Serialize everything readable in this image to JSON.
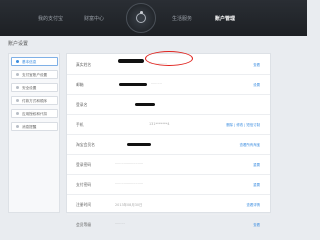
{
  "nav": {
    "items": [
      {
        "label": "我的支付宝"
      },
      {
        "label": "财富中心"
      },
      {
        "label": "生活服务"
      },
      {
        "label": "账户管理",
        "active": true
      }
    ]
  },
  "page": {
    "title": "账户设置"
  },
  "sidebar": {
    "items": [
      {
        "label": "基本信息",
        "active": true
      },
      {
        "label": "支付宝账户设置"
      },
      {
        "label": "安全设置"
      },
      {
        "label": "付款方式和顺序"
      },
      {
        "label": "应用授权和代扣"
      },
      {
        "label": "消息提醒"
      }
    ]
  },
  "rows": [
    {
      "label": "真实姓名",
      "value": "·················",
      "link": "查看"
    },
    {
      "label": "邮箱",
      "value": "··········",
      "link": "设置"
    },
    {
      "label": "登录名",
      "value": "",
      "link": ""
    },
    {
      "label": "手机",
      "value": "131*******4",
      "link": "删除 | 修改 | 短信订制"
    },
    {
      "label": "淘宝会员名",
      "value": "",
      "link": "查看所有淘宝"
    },
    {
      "label": "登录密码",
      "value": "··························",
      "link": "重置"
    },
    {
      "label": "支付密码",
      "value": "··························",
      "link": "重置"
    },
    {
      "label": "注册时间",
      "value": "2013年08月30日",
      "link": "查看详情"
    },
    {
      "label": "会员等级",
      "value": "·········",
      "link": "查看"
    }
  ],
  "colors": {
    "accent": "#3d8ee0",
    "annotation": "#e0231e",
    "topbar": "#1d2024"
  }
}
